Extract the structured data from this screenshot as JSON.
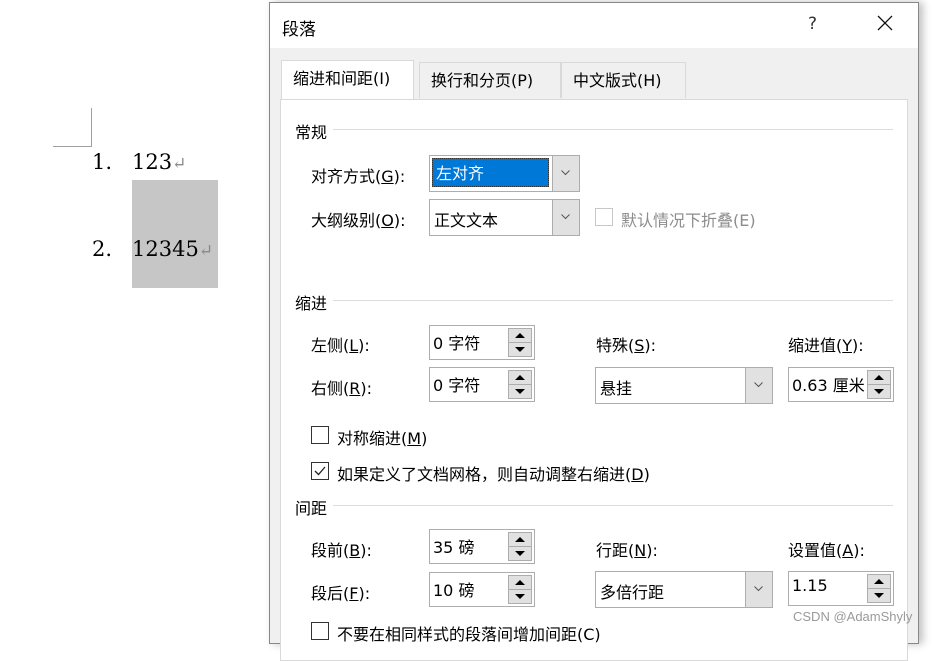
{
  "document": {
    "list": [
      {
        "number": "1.",
        "text": "123",
        "mark": "↵"
      },
      {
        "number": "2.",
        "text": "12345",
        "mark": "↵"
      }
    ]
  },
  "dialog": {
    "title": "段落",
    "help": "?",
    "tabs": [
      {
        "label": "缩进和间距(I)",
        "key": "I",
        "active": true
      },
      {
        "label": "换行和分页(P)",
        "key": "P",
        "active": false
      },
      {
        "label": "中文版式(H)",
        "key": "H",
        "active": false
      }
    ],
    "general": {
      "title": "常规",
      "alignment": {
        "label_pre": "对齐方式(",
        "key": "G",
        "label_post": "):",
        "value": "左对齐"
      },
      "outline": {
        "label_pre": "大纲级别(",
        "key": "O",
        "label_post": "):",
        "value": "正文文本"
      },
      "collapse": {
        "label": "默认情况下折叠(E)",
        "checked": false,
        "disabled": true
      }
    },
    "indent": {
      "title": "缩进",
      "left": {
        "label_pre": "左侧(",
        "key": "L",
        "label_post": "):",
        "value": "0 字符"
      },
      "right": {
        "label_pre": "右侧(",
        "key": "R",
        "label_post": "):",
        "value": "0 字符"
      },
      "special": {
        "label_pre": "特殊(",
        "key": "S",
        "label_post": "):",
        "value": "悬挂"
      },
      "by": {
        "label_pre": "缩进值(",
        "key": "Y",
        "label_post": "):",
        "value": "0.63 厘米"
      },
      "mirror": {
        "label_pre": "对称缩进(",
        "key": "M",
        "label_post": ")",
        "checked": false
      },
      "auto_adjust": {
        "label_pre": "如果定义了文档网格，则自动调整右缩进(",
        "key": "D",
        "label_post": ")",
        "checked": true
      }
    },
    "spacing": {
      "title": "间距",
      "before": {
        "label_pre": "段前(",
        "key": "B",
        "label_post": "):",
        "value": "35 磅"
      },
      "after": {
        "label_pre": "段后(",
        "key": "F",
        "label_post": "):",
        "value": "10 磅"
      },
      "line_spacing": {
        "label_pre": "行距(",
        "key": "N",
        "label_post": "):",
        "value": "多倍行距"
      },
      "at": {
        "label_pre": "设置值(",
        "key": "A",
        "label_post": "):",
        "value": "1.15"
      },
      "dont_add": {
        "label": "不要在相同样式的段落间增加间距(C)",
        "checked": false
      }
    }
  },
  "watermark": "CSDN @AdamShyly"
}
